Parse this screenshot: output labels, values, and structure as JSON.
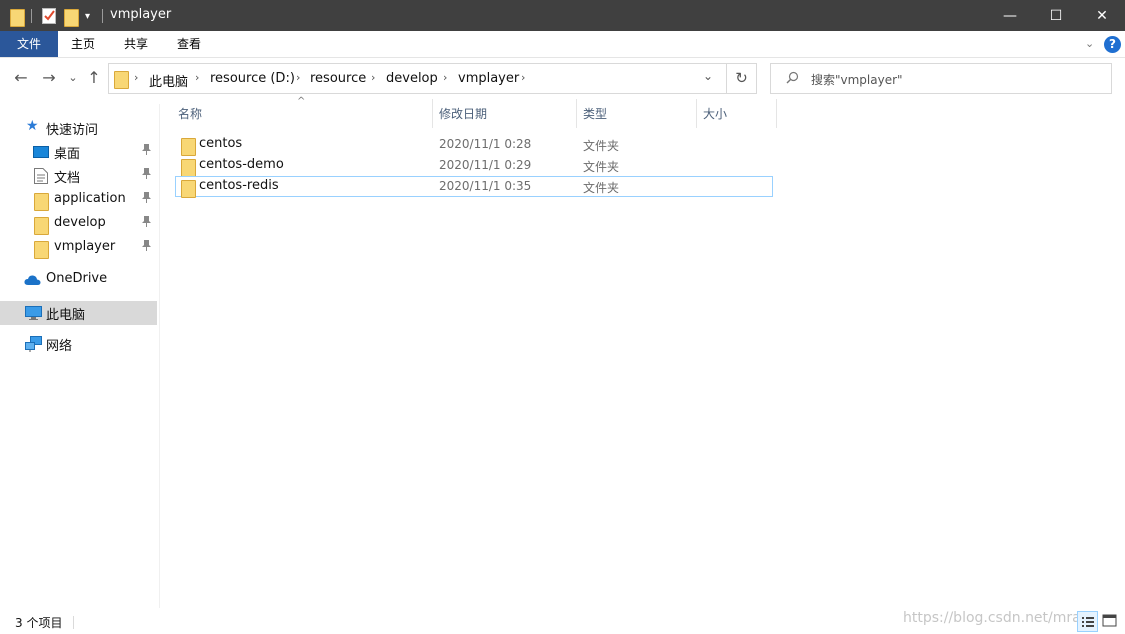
{
  "window": {
    "title": "vmplayer",
    "controls": {
      "minimize": "—",
      "maximize": "☐",
      "close": "✕"
    },
    "qa_dropdown": "▾"
  },
  "ribbon": {
    "tabs": [
      {
        "label": "文件"
      },
      {
        "label": "主页"
      },
      {
        "label": "共享"
      },
      {
        "label": "查看"
      }
    ],
    "expand": "⌄",
    "help": "?"
  },
  "nav": {
    "back": "←",
    "forward": "→",
    "recent": "⌄",
    "up": "↑",
    "breadcrumb": [
      "此电脑",
      "resource (D:)",
      "resource",
      "develop",
      "vmplayer"
    ],
    "separator": "›",
    "dropdown": "⌄",
    "refresh": "↻",
    "search_placeholder": "搜索\"vmplayer\""
  },
  "sidebar": {
    "quick_access": "快速访问",
    "pinned": [
      {
        "label": "桌面",
        "icon": "desktop-icon"
      },
      {
        "label": "文档",
        "icon": "document-icon"
      },
      {
        "label": "application",
        "icon": "folder-icon"
      },
      {
        "label": "develop",
        "icon": "folder-icon"
      },
      {
        "label": "vmplayer",
        "icon": "folder-icon"
      }
    ],
    "pin_glyph": "📌",
    "onedrive": "OneDrive",
    "this_pc": "此电脑",
    "network": "网络"
  },
  "columns": {
    "name": "名称",
    "date": "修改日期",
    "type": "类型",
    "size": "大小",
    "sort_indicator": "^"
  },
  "files": [
    {
      "name": "centos",
      "date": "2020/11/1 0:28",
      "type": "文件夹"
    },
    {
      "name": "centos-demo",
      "date": "2020/11/1 0:29",
      "type": "文件夹"
    },
    {
      "name": "centos-redis",
      "date": "2020/11/1 0:35",
      "type": "文件夹"
    }
  ],
  "status": {
    "item_count": "3 个项目",
    "watermark": "https://blog.csdn.net/mra..."
  },
  "colors": {
    "titlebar": "#404040",
    "file_tab": "#2b579a",
    "folder": "#f8d775",
    "selected_nav": "#d9d9d9",
    "focus_border": "#99d1ff"
  }
}
